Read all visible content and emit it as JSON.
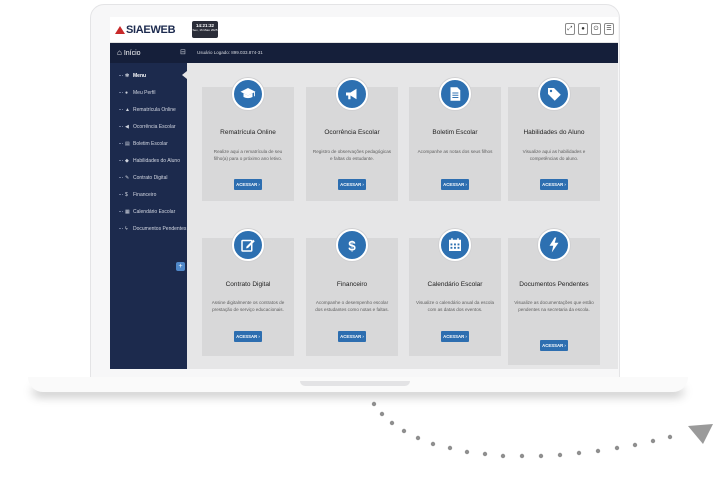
{
  "app": {
    "logo_text": "SIAEWEB",
    "clock_time": "14:21:32",
    "clock_date": "Sex, 16 Maio 2025",
    "toolbar_icons": [
      "expand-icon",
      "user-icon",
      "logout-icon",
      "menu-icon"
    ]
  },
  "header": {
    "home_label": "Início",
    "collapse_glyph": "⊟",
    "user_logged": "Usuário Logado: 899.033.874-31"
  },
  "sidebar": {
    "items": [
      {
        "label": "Menu",
        "icon": "gear-icon",
        "glyph": "✻"
      },
      {
        "label": "Meu Perfil",
        "icon": "user-icon",
        "glyph": "●"
      },
      {
        "label": "Rematrícula Online",
        "icon": "graduation-cap-icon",
        "glyph": "▲"
      },
      {
        "label": "Ocorrência Escolar",
        "icon": "megaphone-icon",
        "glyph": "◀"
      },
      {
        "label": "Boletim Escolar",
        "icon": "document-icon",
        "glyph": "▤"
      },
      {
        "label": "Habilidades do Aluno",
        "icon": "tag-icon",
        "glyph": "◆"
      },
      {
        "label": "Contrato Digital",
        "icon": "edit-icon",
        "glyph": "✎"
      },
      {
        "label": "Financeiro",
        "icon": "dollar-icon",
        "glyph": "$"
      },
      {
        "label": "Calendário Escolar",
        "icon": "calendar-icon",
        "glyph": "▦"
      },
      {
        "label": "Documentos Pendentes",
        "icon": "bolt-icon",
        "glyph": "ϟ"
      }
    ],
    "plus_glyph": "+"
  },
  "cards": [
    {
      "title": "Rematrícula Online",
      "desc": "Realize aqui a rematrícula de seu filho(a) para o próximo ano letivo.",
      "button": "ACESSAR ›",
      "icon": "graduation-cap-icon"
    },
    {
      "title": "Ocorrência Escolar",
      "desc": "Registro de observações pedagógicas e faltas do estudante.",
      "button": "ACESSAR ›",
      "icon": "megaphone-icon"
    },
    {
      "title": "Boletim Escolar",
      "desc": "Acompanhe as notas dos seus filhos",
      "button": "ACESSAR ›",
      "icon": "document-icon"
    },
    {
      "title": "Habilidades do Aluno",
      "desc": "Visualize aqui as habilidades e competências do aluno.",
      "button": "ACESSAR ›",
      "icon": "tag-icon"
    },
    {
      "title": "Contrato Digital",
      "desc": "Assine digitalmente os contratos de prestação de serviço educacionais.",
      "button": "ACESSAR ›",
      "icon": "edit-icon"
    },
    {
      "title": "Financeiro",
      "desc": "Acompanhe o desempenho escolar dos estudantes como notas e faltas.",
      "button": "ACESSAR ›",
      "icon": "dollar-icon"
    },
    {
      "title": "Calendário Escolar",
      "desc": "Visualize o calendário anual da escola com as datas dos eventos.",
      "button": "ACESSAR ›",
      "icon": "calendar-icon"
    },
    {
      "title": "Documentos Pendentes",
      "desc": "Visualize as documentações que estão pendentes na secretaria da escola.",
      "button": "ACESSAR ›",
      "icon": "bolt-icon"
    }
  ],
  "colors": {
    "accent": "#2d70b1",
    "sidebar": "#1c2a4d",
    "header": "#151f3a",
    "logo_mark": "#c82a2a"
  }
}
